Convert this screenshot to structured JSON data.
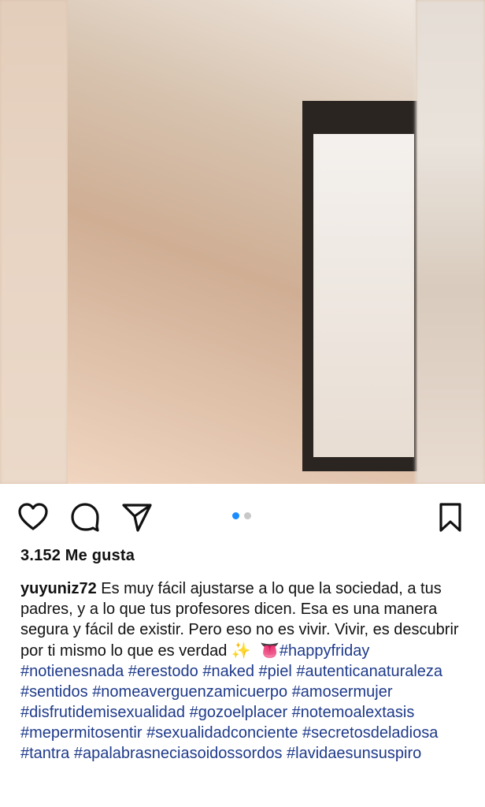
{
  "post": {
    "likes_text": "3.152 Me gusta",
    "carousel": {
      "total": 2,
      "active_index": 0
    },
    "caption": {
      "username": "yuyuniz72",
      "text": " Es muy fácil ajustarse a lo que la sociedad, a tus padres, y a lo que tus profesores dicen. Esa es una manera segura y fácil de existir. Pero eso no es vivir. Vivir, es descubrir por ti mismo lo que es verdad ",
      "emoji_sparkles": "✨",
      "emoji_devil": "👅",
      "hashtags": [
        "#happyfriday",
        "#notienesnada",
        "#erestodo",
        "#naked",
        "#piel",
        "#autenticanaturaleza",
        "#sentidos",
        "#nomeaverguenzamicuerpo",
        "#amosermujer",
        "#disfrutidemisexualidad",
        "#gozoelplacer",
        "#notemoalextasis",
        "#mepermitosentir",
        "#sexualidadconciente",
        "#secretosdeladiosa",
        "#tantra",
        "#apalabrasneciasoidossordos",
        "#lavidaesunsuspiro"
      ]
    }
  },
  "icons": {
    "like": "heart-icon",
    "comment": "comment-bubble-icon",
    "share": "paper-plane-icon",
    "save": "bookmark-icon"
  },
  "colors": {
    "hashtag": "#1e3a8a",
    "carousel_active": "#1a8cff",
    "carousel_inactive": "#c8c8c8"
  }
}
